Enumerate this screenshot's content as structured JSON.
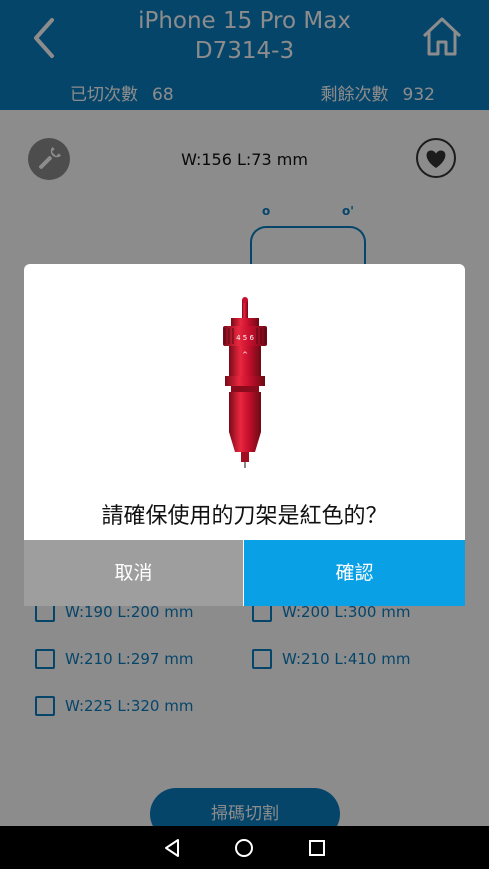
{
  "header": {
    "title_line1": "iPhone 15 Pro Max",
    "title_line2": "D7314-3",
    "cut_count_label": "已切次數",
    "cut_count": "68",
    "remaining_label": "剩餘次數",
    "remaining": "932"
  },
  "main": {
    "dimensions": "W:156 L:73 mm",
    "sizes": [
      "W:190 L:200 mm",
      "W:200 L:300 mm",
      "W:210 L:297 mm",
      "W:210 L:410 mm",
      "W:225 L:320 mm"
    ],
    "scan_button": "掃碼切割"
  },
  "dialog": {
    "message": "請確保使用的刀架是紅色的？",
    "cancel_label": "取消",
    "confirm_label": "確認"
  },
  "colors": {
    "header_blue": "#0a7fc1",
    "confirm_blue": "#0aa0e6",
    "cancel_gray": "#9e9e9e",
    "blade_red": "#c8102e"
  }
}
